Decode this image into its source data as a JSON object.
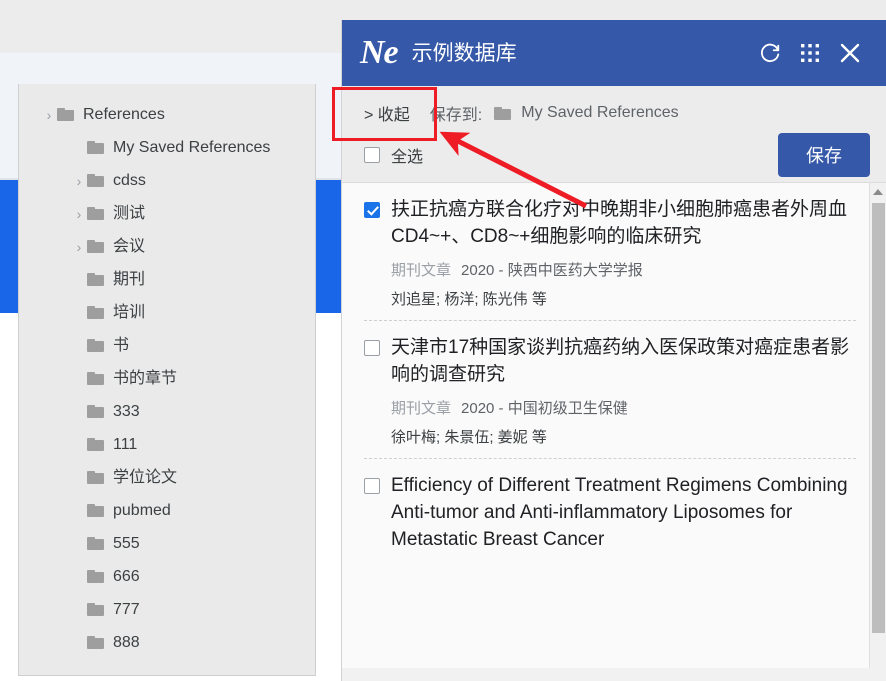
{
  "background": {
    "accent_blue": "#1a66e8"
  },
  "sidebar": {
    "name": "folder-tree-flyout",
    "items": [
      {
        "label": "References",
        "indent": 0,
        "caret": "chevron-right"
      },
      {
        "label": "My Saved References",
        "indent": 1,
        "caret": ""
      },
      {
        "label": "cdss",
        "indent": 1,
        "caret": "chevron-right"
      },
      {
        "label": "测试",
        "indent": 1,
        "caret": "chevron-right"
      },
      {
        "label": "会议",
        "indent": 1,
        "caret": "chevron-right"
      },
      {
        "label": "期刊",
        "indent": 1,
        "caret": ""
      },
      {
        "label": "培训",
        "indent": 1,
        "caret": ""
      },
      {
        "label": "书",
        "indent": 1,
        "caret": ""
      },
      {
        "label": "书的章节",
        "indent": 1,
        "caret": ""
      },
      {
        "label": "333",
        "indent": 1,
        "caret": ""
      },
      {
        "label": "111",
        "indent": 1,
        "caret": ""
      },
      {
        "label": "学位论文",
        "indent": 1,
        "caret": ""
      },
      {
        "label": "pubmed",
        "indent": 1,
        "caret": ""
      },
      {
        "label": "555",
        "indent": 1,
        "caret": ""
      },
      {
        "label": "666",
        "indent": 1,
        "caret": ""
      },
      {
        "label": "777",
        "indent": 1,
        "caret": ""
      },
      {
        "label": "888",
        "indent": 1,
        "caret": ""
      }
    ]
  },
  "popup": {
    "header": {
      "logo_text": "Ne",
      "title": "示例数据库",
      "brand_color": "#3558a8",
      "icons": [
        {
          "name": "refresh-icon",
          "glyph": "refresh"
        },
        {
          "name": "apps-grid-icon",
          "glyph": "grid"
        },
        {
          "name": "close-icon",
          "glyph": "close"
        }
      ]
    },
    "toolbar": {
      "collapse_label": "> 收起",
      "save_to_label": "保存到:",
      "save_to_folder": "My Saved References",
      "select_all_label": "全选",
      "save_button_label": "保存",
      "save_button_color": "#3558a8",
      "select_all_checked": false
    },
    "results": [
      {
        "checked": true,
        "title": "扶正抗癌方联合化疗对中晚期非小细胞肺癌患者外周血CD4~+、CD8~+细胞影响的临床研究",
        "type": "期刊文章",
        "year": "2020",
        "source": "陕西中医药大学学报",
        "meta": "期刊文章  2020 - 陕西中医药大学学报",
        "authors": "刘追星; 杨洋; 陈光伟 等"
      },
      {
        "checked": false,
        "title": "天津市17种国家谈判抗癌药纳入医保政策对癌症患者影响的调查研究",
        "type": "期刊文章",
        "year": "2020",
        "source": "中国初级卫生保健",
        "meta": "期刊文章  2020 - 中国初级卫生保健",
        "authors": "徐叶梅; 朱景伍; 姜妮 等"
      },
      {
        "checked": false,
        "title": "Efficiency of Different Treatment Regimens Combining Anti-tumor and Anti-inflammatory Liposomes for Metastatic Breast Cancer",
        "type": "",
        "year": "",
        "source": "",
        "meta": "",
        "authors": ""
      }
    ],
    "scrollbar": {
      "name": "results-scrollbar"
    }
  },
  "annotations": {
    "highlight_color": "#ee1c25",
    "box_target": "collapse-link",
    "arrow_points_to": "toolbar-row"
  }
}
